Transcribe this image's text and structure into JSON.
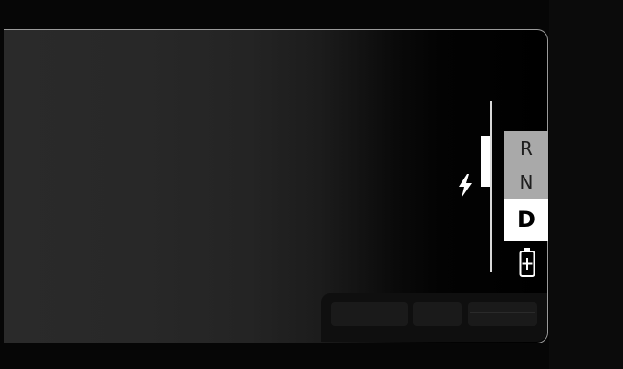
{
  "gear_selector": {
    "gears": [
      "R",
      "N",
      "D"
    ],
    "selected": "D"
  },
  "icons": {
    "power": "lightning-bolt-icon",
    "battery": "battery-icon"
  },
  "power_gauge": {
    "indicator_label": "power-meter"
  },
  "colors": {
    "gear_inactive_bg": "#a9a9a9",
    "gear_active_bg": "#ffffff",
    "panel_outline": "#9a9a9a",
    "gauge": "#ffffff"
  }
}
